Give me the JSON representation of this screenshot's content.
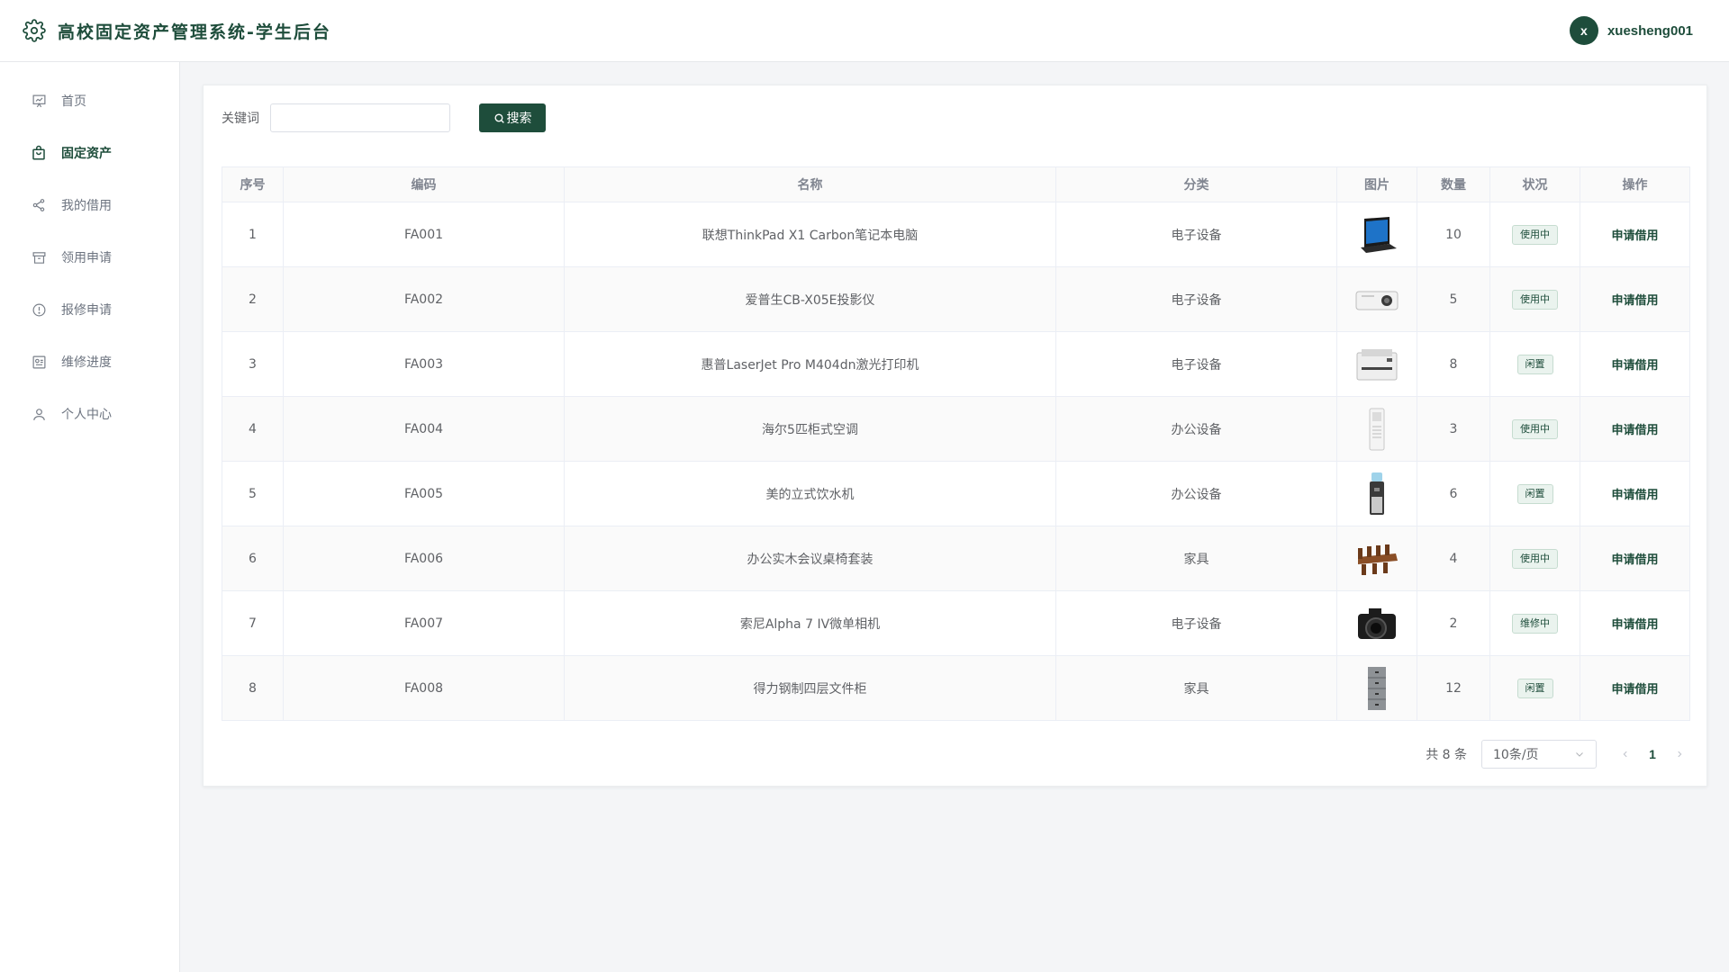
{
  "header": {
    "title": "高校固定资产管理系统-学生后台",
    "user": {
      "avatar_letter": "x",
      "name": "xuesheng001"
    }
  },
  "sidebar": {
    "items": [
      {
        "label": "首页",
        "icon": "presentation-icon"
      },
      {
        "label": "固定资产",
        "icon": "shopping-bag-icon",
        "active": true
      },
      {
        "label": "我的借用",
        "icon": "share-icon"
      },
      {
        "label": "领用申请",
        "icon": "archive-box-icon"
      },
      {
        "label": "报修申请",
        "icon": "alert-circle-icon"
      },
      {
        "label": "维修进度",
        "icon": "progress-chart-icon"
      },
      {
        "label": "个人中心",
        "icon": "user-icon"
      }
    ]
  },
  "search": {
    "label": "关键词",
    "value": "",
    "placeholder": "",
    "button_label": "搜索"
  },
  "table": {
    "columns": [
      "序号",
      "编码",
      "名称",
      "分类",
      "图片",
      "数量",
      "状况",
      "操作"
    ],
    "rows": [
      {
        "index": "1",
        "code": "FA001",
        "name": "联想ThinkPad X1 Carbon笔记本电脑",
        "category": "电子设备",
        "image": "laptop",
        "qty": "10",
        "status": "使用中",
        "action": "申请借用"
      },
      {
        "index": "2",
        "code": "FA002",
        "name": "爱普生CB-X05E投影仪",
        "category": "电子设备",
        "image": "projector",
        "qty": "5",
        "status": "使用中",
        "action": "申请借用"
      },
      {
        "index": "3",
        "code": "FA003",
        "name": "惠普LaserJet Pro M404dn激光打印机",
        "category": "电子设备",
        "image": "printer",
        "qty": "8",
        "status": "闲置",
        "action": "申请借用"
      },
      {
        "index": "4",
        "code": "FA004",
        "name": "海尔5匹柜式空调",
        "category": "办公设备",
        "image": "air-conditioner",
        "qty": "3",
        "status": "使用中",
        "action": "申请借用"
      },
      {
        "index": "5",
        "code": "FA005",
        "name": "美的立式饮水机",
        "category": "办公设备",
        "image": "water-dispenser",
        "qty": "6",
        "status": "闲置",
        "action": "申请借用"
      },
      {
        "index": "6",
        "code": "FA006",
        "name": "办公实木会议桌椅套装",
        "category": "家具",
        "image": "conference-table",
        "qty": "4",
        "status": "使用中",
        "action": "申请借用"
      },
      {
        "index": "7",
        "code": "FA007",
        "name": "索尼Alpha 7 IV微单相机",
        "category": "电子设备",
        "image": "camera",
        "qty": "2",
        "status": "维修中",
        "action": "申请借用"
      },
      {
        "index": "8",
        "code": "FA008",
        "name": "得力钢制四层文件柜",
        "category": "家具",
        "image": "file-cabinet",
        "qty": "12",
        "status": "闲置",
        "action": "申请借用"
      }
    ]
  },
  "pagination": {
    "total": "共 8 条",
    "page_size": "10条/页",
    "current_page": "1"
  },
  "colors": {
    "accent": "#1e4d3b",
    "badge_bg": "#eaf3ee",
    "stripe": "#fafafa"
  }
}
